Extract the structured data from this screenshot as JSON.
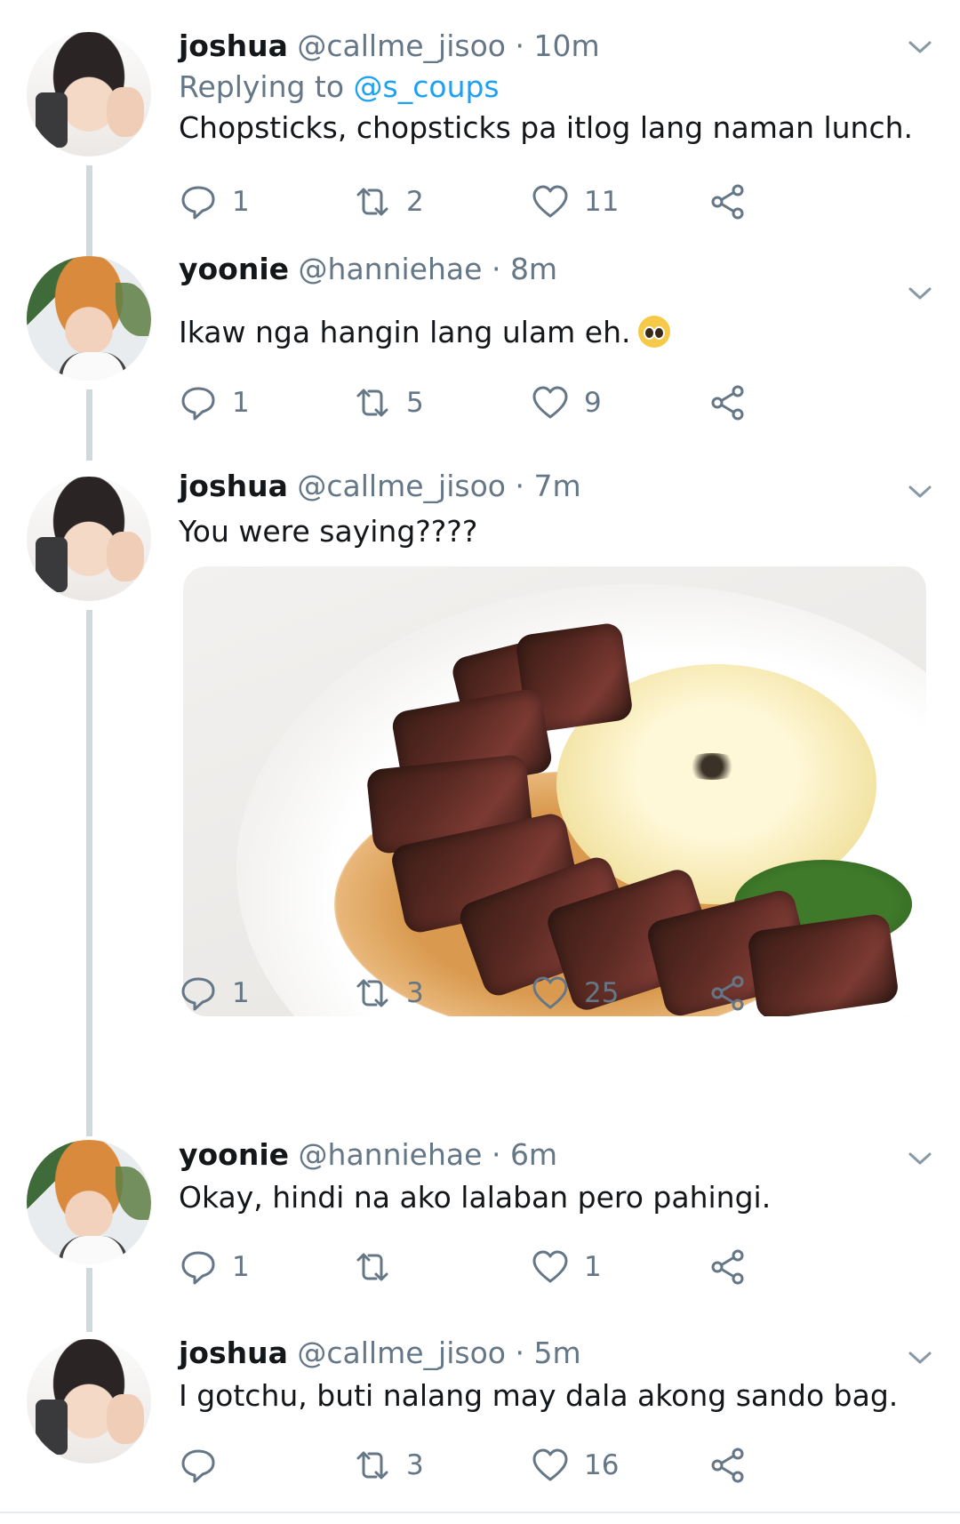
{
  "tweets": [
    {
      "name": "joshua",
      "handle": "@callme_jisoo",
      "time": "10m",
      "replying_label": "Replying to",
      "replying_handle": "@s_coups",
      "text": "Chopsticks, chopsticks pa itlog lang naman lunch.",
      "replies": "1",
      "retweets": "2",
      "likes": "11"
    },
    {
      "name": "yoonie",
      "handle": "@hanniehae",
      "time": "8m",
      "text": "Ikaw nga hangin lang ulam eh.",
      "replies": "1",
      "retweets": "5",
      "likes": "9"
    },
    {
      "name": "joshua",
      "handle": "@callme_jisoo",
      "time": "7m",
      "text": "You were saying????",
      "replies": "1",
      "retweets": "3",
      "likes": "25"
    },
    {
      "name": "yoonie",
      "handle": "@hanniehae",
      "time": "6m",
      "text": "Okay, hindi na ako lalaban pero pahingi.",
      "replies": "1",
      "retweets": "",
      "likes": "1"
    },
    {
      "name": "joshua",
      "handle": "@callme_jisoo",
      "time": "5m",
      "text": "I gotchu, buti nalang may dala akong sando bag.",
      "replies": "",
      "retweets": "3",
      "likes": "16"
    }
  ],
  "separator": "·",
  "icons": {
    "reply": "reply-icon",
    "retweet": "retweet-icon",
    "like": "heart-icon",
    "share": "share-icon",
    "menu": "chevron-down-icon"
  },
  "colors": {
    "text": "#14171a",
    "muted": "#657786",
    "link": "#1da1f2",
    "thread_line": "#cfd9de"
  }
}
